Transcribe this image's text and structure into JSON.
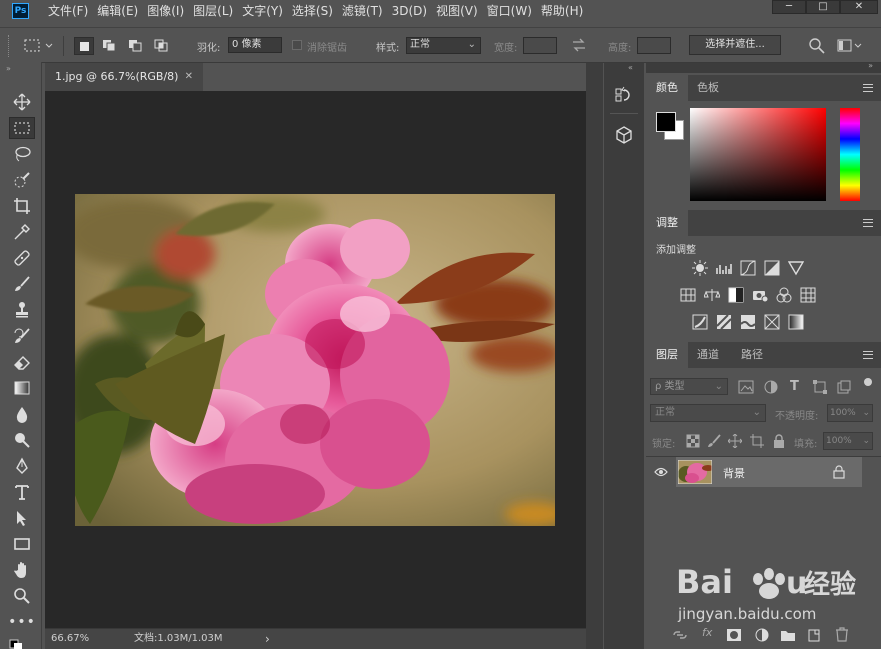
{
  "app": {
    "logo": "Ps"
  },
  "menu": [
    "文件(F)",
    "编辑(E)",
    "图像(I)",
    "图层(L)",
    "文字(Y)",
    "选择(S)",
    "滤镜(T)",
    "3D(D)",
    "视图(V)",
    "窗口(W)",
    "帮助(H)"
  ],
  "window_controls": {
    "minimize": "─",
    "maximize": "□",
    "close": "✕"
  },
  "options": {
    "feather_label": "羽化:",
    "feather_value": "0 像素",
    "antialias_label": "消除锯齿",
    "style_label": "样式:",
    "style_value": "正常",
    "width_label": "宽度:",
    "height_label": "高度:",
    "select_mask_button": "选择并遮住..."
  },
  "document": {
    "tab_title": "1.jpg @ 66.7%(RGB/8)",
    "tab_close": "✕",
    "zoom": "66.67%",
    "doc_info": "文档:1.03M/1.03M",
    "status_arrow": "›"
  },
  "panels": {
    "color": {
      "tabs": [
        "颜色",
        "色板"
      ],
      "foreground": "#000000",
      "background": "#ffffff",
      "hue_base": "#ff0000"
    },
    "adjustments": {
      "tab": "调整",
      "add_label": "添加调整"
    },
    "layers": {
      "tabs": [
        "图层",
        "通道",
        "路径"
      ],
      "filter_kind": "ρ 类型",
      "blend_mode": "正常",
      "opacity_label": "不透明度:",
      "opacity_value": "100%",
      "lock_label": "锁定:",
      "fill_label": "填充:",
      "fill_value": "100%",
      "layer_name": "背景"
    }
  },
  "watermark": {
    "brand": "Baidu经验",
    "url": "jingyan.baidu.com"
  },
  "colors": {
    "accent": "#31a8ff",
    "ui_dark": "#282828",
    "ui_panel": "#535353"
  }
}
